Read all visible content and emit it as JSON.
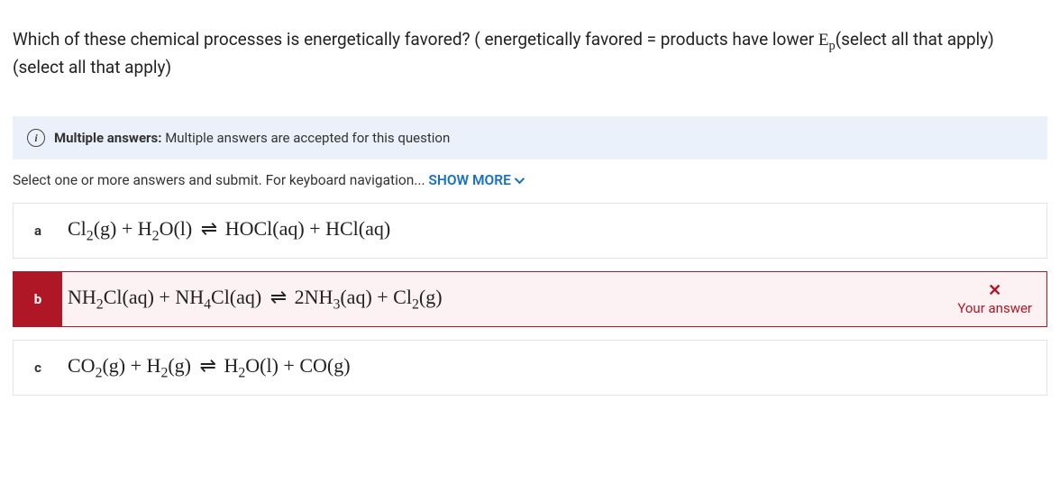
{
  "question": {
    "part1": "Which of these chemical processes is energetically favored? ( energetically favored = products have lower ",
    "ep_base": "E",
    "ep_sub": "p",
    "part2": "(select all that apply) (select all that apply)"
  },
  "info_banner": {
    "title": "Multiple answers:",
    "text": " Multiple answers are accepted for this question"
  },
  "instructions": {
    "text": "Select one or more answers and submit. For keyboard navigation... ",
    "show_more": "SHOW MORE"
  },
  "options": [
    {
      "letter": "a",
      "formula_html": "Cl<sub>2</sub>(g) + H<sub>2</sub>O(l) <span class='eq'>⇌</span> HOCl(aq) + HCl(aq)",
      "state": "neutral"
    },
    {
      "letter": "b",
      "formula_html": "NH<sub>2</sub>Cl(aq) + NH<sub>4</sub>Cl(aq) <span class='eq'>⇌</span> 2NH<sub>3</sub>(aq) + Cl<sub>2</sub>(g)",
      "state": "wrong"
    },
    {
      "letter": "c",
      "formula_html": "CO<sub>2</sub>(g) + H<sub>2</sub>(g) <span class='eq'>⇌</span> H<sub>2</sub>O(l) + CO(g)",
      "state": "neutral"
    }
  ],
  "feedback": {
    "x": "✕",
    "your_answer": "Your answer"
  }
}
